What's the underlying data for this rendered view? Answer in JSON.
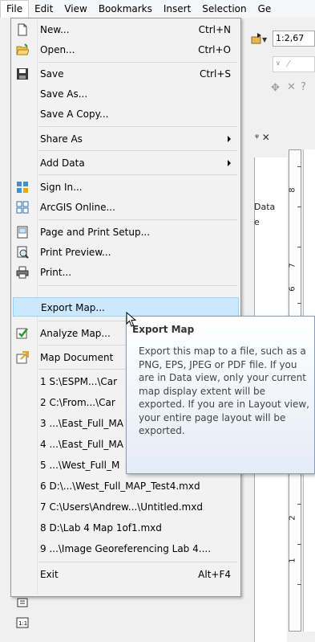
{
  "menubar": {
    "items": [
      "File",
      "Edit",
      "View",
      "Bookmarks",
      "Insert",
      "Selection",
      "Ge"
    ]
  },
  "toolbar": {
    "scale": "1:2,67"
  },
  "layout_panel": {
    "text_data": "Data",
    "text_e": "e"
  },
  "ruler": {
    "labels": [
      "8",
      "7",
      "6",
      "2",
      "1"
    ]
  },
  "menu": {
    "items": [
      {
        "label": "New...",
        "shortcut": "Ctrl+N",
        "icon": "new-document-icon"
      },
      {
        "label": "Open...",
        "shortcut": "Ctrl+O",
        "icon": "open-folder-icon"
      },
      {
        "label": "Save",
        "shortcut": "Ctrl+S",
        "icon": "save-disk-icon"
      },
      {
        "label": "Save As...",
        "shortcut": "",
        "icon": ""
      },
      {
        "label": "Save A Copy...",
        "shortcut": "",
        "icon": ""
      },
      {
        "label": "Share As",
        "shortcut": "",
        "icon": "",
        "submenu": true
      },
      {
        "label": "Add Data",
        "shortcut": "",
        "icon": "",
        "submenu": true
      },
      {
        "label": "Sign In...",
        "shortcut": "",
        "icon": "sign-in-icon"
      },
      {
        "label": "ArcGIS Online...",
        "shortcut": "",
        "icon": "arcgis-online-icon"
      },
      {
        "label": "Page and Print Setup...",
        "shortcut": "",
        "icon": "page-setup-icon"
      },
      {
        "label": "Print Preview...",
        "shortcut": "",
        "icon": "print-preview-icon"
      },
      {
        "label": "Print...",
        "shortcut": "",
        "icon": "printer-icon"
      },
      {
        "label": "Export Map...",
        "shortcut": "",
        "icon": ""
      },
      {
        "label": "Analyze Map...",
        "shortcut": "",
        "icon": "analyze-map-icon"
      },
      {
        "label": "Map Document",
        "shortcut": "",
        "icon": "map-document-icon"
      },
      {
        "label": "1 S:\\ESPM...\\Car",
        "shortcut": "",
        "icon": ""
      },
      {
        "label": "2 C:\\From...\\Car",
        "shortcut": "",
        "icon": ""
      },
      {
        "label": "3 ...\\East_Full_MA",
        "shortcut": "",
        "icon": ""
      },
      {
        "label": "4 ...\\East_Full_MA",
        "shortcut": "",
        "icon": ""
      },
      {
        "label": "5 ...\\West_Full_M",
        "shortcut": "",
        "icon": ""
      },
      {
        "label": "6 D:\\...\\West_Full_MAP_Test4.mxd",
        "shortcut": "",
        "icon": ""
      },
      {
        "label": "7 C:\\Users\\Andrew...\\Untitled.mxd",
        "shortcut": "",
        "icon": ""
      },
      {
        "label": "8 D:\\Lab 4 Map 1of1.mxd",
        "shortcut": "",
        "icon": ""
      },
      {
        "label": "9 ...\\Image Georeferencing Lab 4....",
        "shortcut": "",
        "icon": ""
      },
      {
        "label": "Exit",
        "shortcut": "Alt+F4",
        "icon": ""
      }
    ]
  },
  "tooltip": {
    "title": "Export Map",
    "body": "Export this map to a file, such as a PNG, EPS, JPEG or PDF file. If you are in Data view, only your current map display extent will be exported. If you are in Layout view, your entire page layout will be exported."
  },
  "colors": {
    "highlight_bg": "#cce8ff",
    "highlight_border": "#99d1ff",
    "tooltip_border": "#8a9bb3"
  }
}
